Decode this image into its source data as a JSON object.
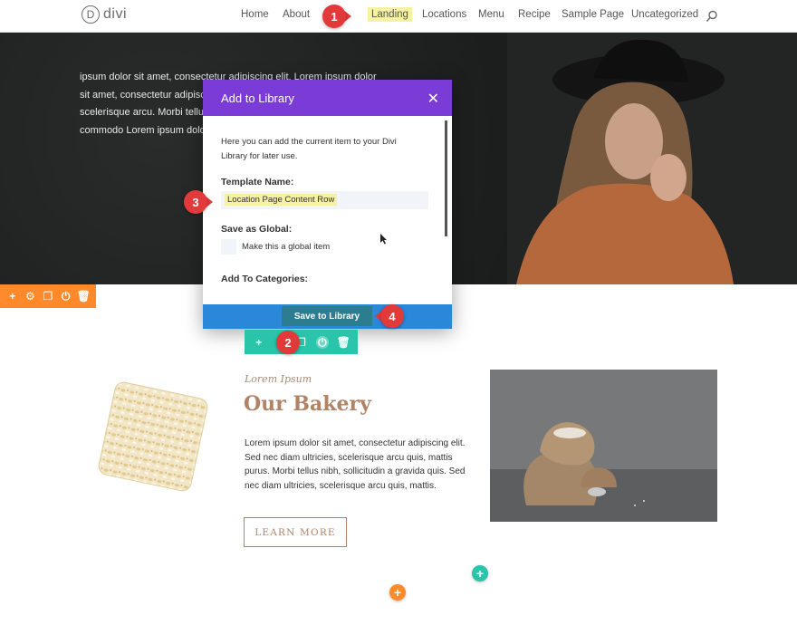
{
  "header": {
    "logo_letter": "D",
    "logo_word": "divi",
    "nav": [
      "Home",
      "About",
      "Landing",
      "Locations",
      "Menu",
      "Recipe",
      "Sample Page",
      "Uncategorized"
    ],
    "active_nav": "Landing"
  },
  "hero": {
    "text": "ipsum dolor sit amet, consectetur adipiscing elit. Lorem ipsum dolor sit amet, consectetur adipiscing elit. Sed nec diam ultricies, scelerisque arcu. Morbi tellus nibh, sollicitudin a gravida quis, commodo Lorem ipsum dolo"
  },
  "modal": {
    "title": "Add to Library",
    "description": "Here you can add the current item to your Divi Library for later use.",
    "template_name_label": "Template Name:",
    "template_name_value": "Location Page Content Row",
    "save_as_global_label": "Save as Global:",
    "global_checkbox_label": "Make this a global item",
    "categories_label": "Add To Categories:",
    "save_button": "Save to Library"
  },
  "callouts": [
    "1",
    "2",
    "3",
    "4"
  ],
  "content": {
    "eyebrow": "Lorem Ipsum",
    "heading": "Our Bakery",
    "paragraph": "Lorem ipsum dolor sit amet, consectetur adipiscing elit. Sed nec diam ultricies, scelerisque arcu quis, mattis purus. Morbi tellus nibh, sollicitudin a gravida quis. Sed nec diam ultricies, scelerisque arcu quis, mattis.",
    "button": "LEARN MORE"
  },
  "colors": {
    "modal_header": "#7a3bd6",
    "save_bar": "#2b87da",
    "section_toolbar": "#ff8a2b",
    "row_toolbar": "#29c4a9",
    "callout": "#e23a3a",
    "highlight": "#f6f2a4",
    "accent_text": "#b08367"
  },
  "icons": {
    "section_tools": [
      "plus-icon",
      "gear-icon",
      "duplicate-icon",
      "power-icon",
      "trash-icon"
    ],
    "row_tools": [
      "plus-icon",
      "gear-icon",
      "duplicate-icon",
      "save-to-library-icon",
      "trash-icon"
    ]
  }
}
